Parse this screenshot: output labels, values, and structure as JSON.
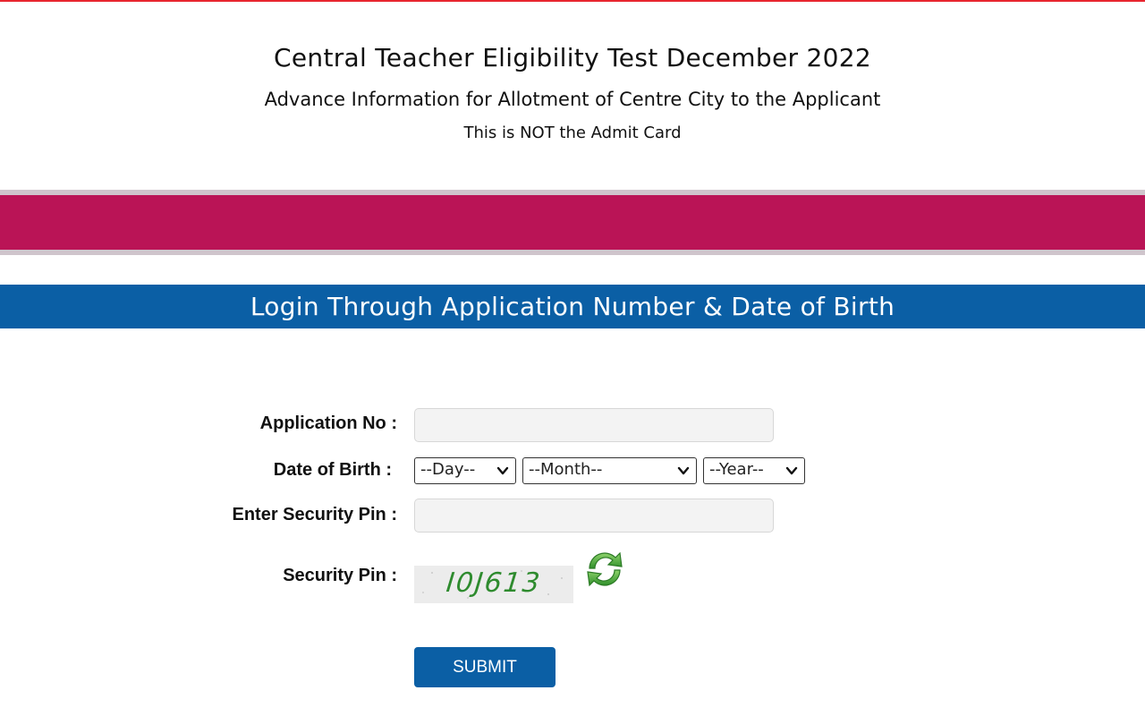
{
  "header": {
    "title": "Central Teacher Eligibility Test December 2022",
    "subtitle": "Advance Information for Allotment of Centre City to the Applicant",
    "note": "This is NOT the Admit Card"
  },
  "login_bar": {
    "title": "Login Through Application Number & Date of Birth"
  },
  "form": {
    "application_no": {
      "label": "Application No :",
      "value": "",
      "placeholder": ""
    },
    "date_of_birth": {
      "label": "Date of Birth :",
      "day": "--Day--",
      "month": "--Month--",
      "year": "--Year--"
    },
    "security_pin_input": {
      "label": "Enter Security Pin :",
      "value": "",
      "placeholder": ""
    },
    "security_pin": {
      "label": "Security Pin :",
      "captcha": "I0J613"
    },
    "submit_label": "SUBMIT"
  },
  "colors": {
    "top_line": "#e8252f",
    "band": "#ba1456",
    "band_border": "#cfc5cc",
    "primary_blue": "#0b5fa5",
    "captcha_green": "#2e8b2e",
    "refresh_green": "#3fa535"
  },
  "icons": {
    "refresh": "refresh-icon",
    "dropdown": "chevron-down-icon"
  }
}
